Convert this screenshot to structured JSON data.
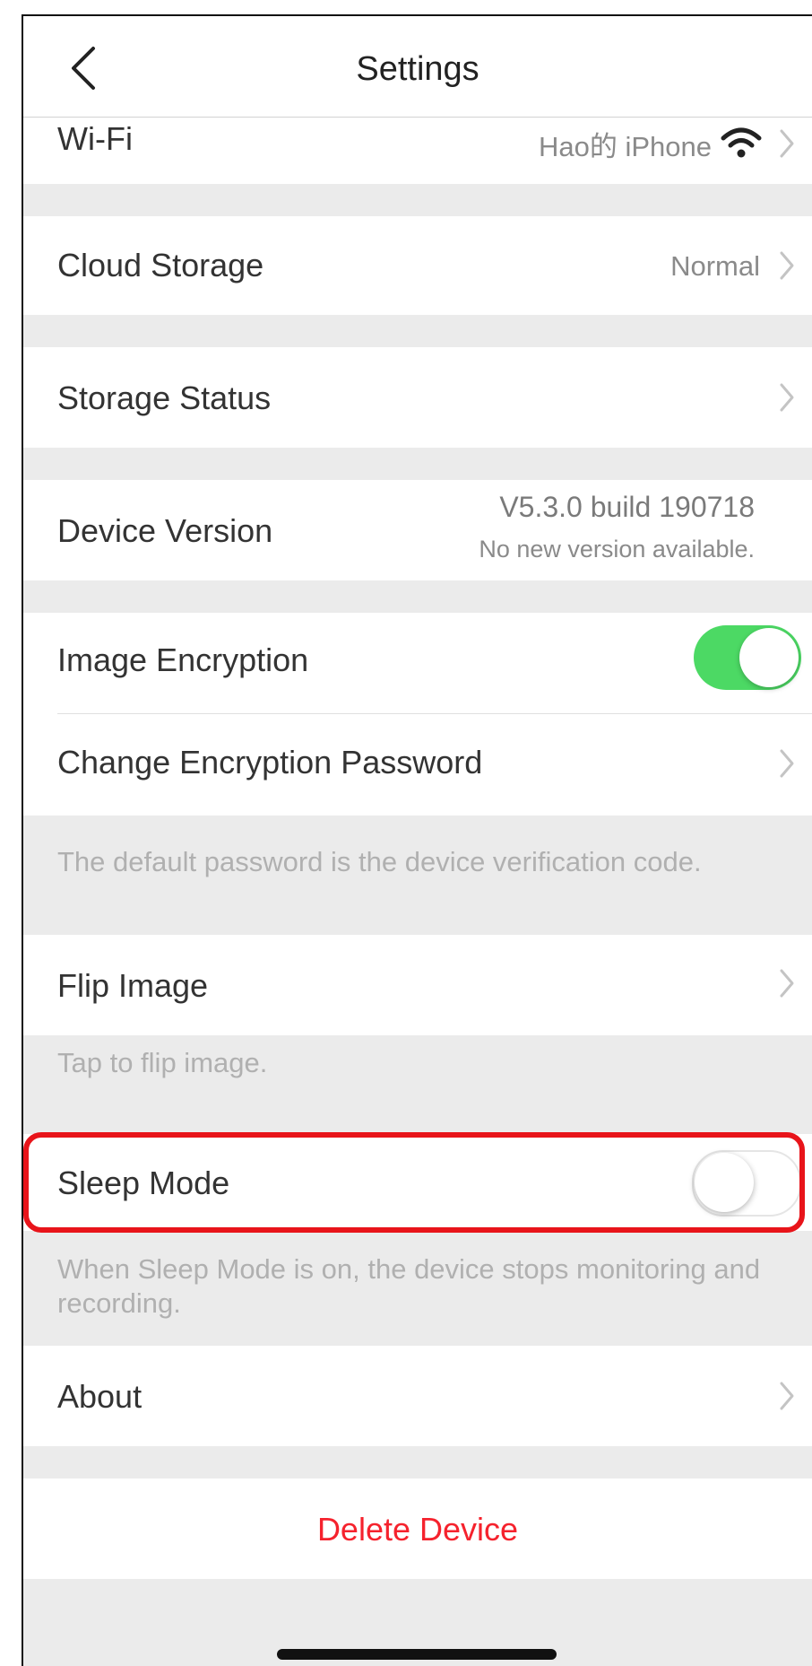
{
  "nav": {
    "title": "Settings",
    "back_icon": "chevron-left-icon"
  },
  "wifi": {
    "label": "Wi-Fi",
    "value": "Hao的 iPhone",
    "icon": "wifi-icon"
  },
  "cloud_storage": {
    "label": "Cloud Storage",
    "value": "Normal"
  },
  "storage_status": {
    "label": "Storage Status"
  },
  "device_version": {
    "label": "Device Version",
    "version": "V5.3.0 build 190718",
    "status": "No new version available."
  },
  "image_encryption": {
    "label": "Image Encryption",
    "enabled": true
  },
  "change_password": {
    "label": "Change Encryption Password",
    "note": "The default password is the device verification code."
  },
  "flip_image": {
    "label": "Flip Image",
    "note": "Tap to flip image."
  },
  "sleep_mode": {
    "label": "Sleep Mode",
    "enabled": false,
    "note": "When Sleep Mode is on, the device stops monitoring and recording."
  },
  "about": {
    "label": "About"
  },
  "delete_device": {
    "label": "Delete Device"
  },
  "colors": {
    "accent_green": "#4cd964",
    "delete_red": "#f5222d",
    "highlight_red": "#e8141a"
  }
}
